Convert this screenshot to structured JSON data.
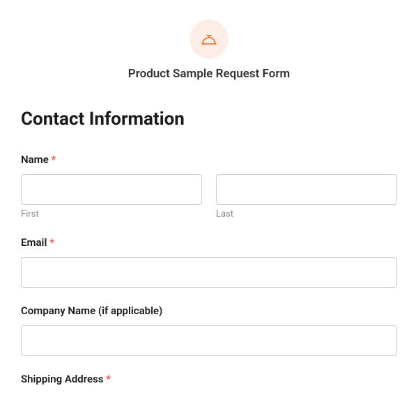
{
  "header": {
    "title": "Product Sample Request Form"
  },
  "section": {
    "title": "Contact Information"
  },
  "fields": {
    "name": {
      "label": "Name",
      "required_mark": "*",
      "first_sublabel": "First",
      "last_sublabel": "Last",
      "first_value": "",
      "last_value": ""
    },
    "email": {
      "label": "Email",
      "required_mark": "*",
      "value": ""
    },
    "company": {
      "label": "Company Name (if applicable)",
      "value": ""
    },
    "shipping": {
      "label": "Shipping Address",
      "required_mark": "*"
    }
  }
}
